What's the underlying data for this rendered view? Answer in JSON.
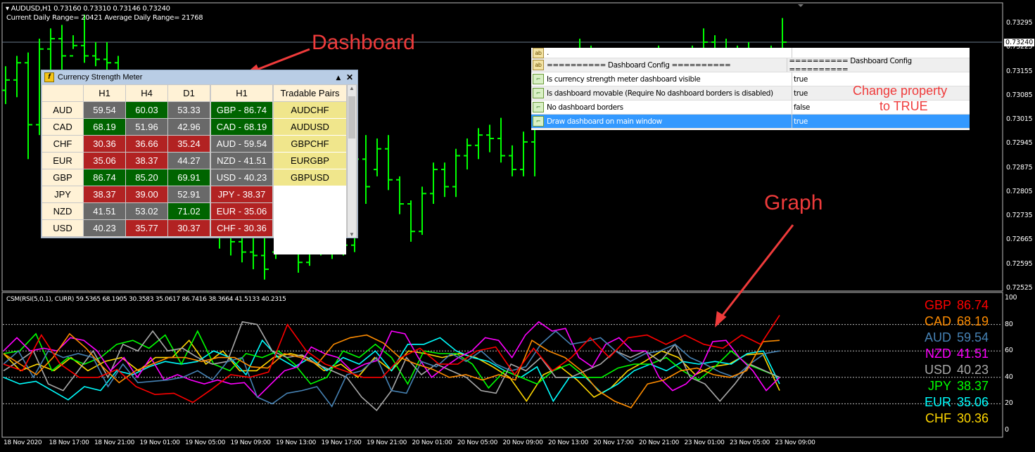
{
  "header": {
    "symbol_line": "AUDUSD,H1  0.73160 0.73310 0.73146 0.73240",
    "range_line": "Current Daily Range= 20421    Average Daily Range= 21768"
  },
  "price_axis": {
    "labels": [
      "0.73295",
      "0.73225",
      "0.73155",
      "0.73085",
      "0.73015",
      "0.72945",
      "0.72875",
      "0.72805",
      "0.72735",
      "0.72665",
      "0.72595",
      "0.72525"
    ],
    "current": "0.73240",
    "current_value": 0.7324
  },
  "price_bars_ohlc": [
    [
      0.731,
      0.7317,
      0.7306,
      0.7313
    ],
    [
      0.7313,
      0.732,
      0.7308,
      0.7318
    ],
    [
      0.7318,
      0.7321,
      0.729,
      0.73
    ],
    [
      0.73,
      0.7325,
      0.7297,
      0.7322
    ],
    [
      0.7322,
      0.7328,
      0.7316,
      0.7325
    ],
    [
      0.7325,
      0.7329,
      0.7315,
      0.732
    ],
    [
      0.732,
      0.7326,
      0.7322,
      0.7323
    ],
    [
      0.7323,
      0.7332,
      0.7318,
      0.732
    ],
    [
      0.732,
      0.7324,
      0.7317,
      0.7319
    ],
    [
      0.7319,
      0.7324,
      0.7316,
      0.7318
    ],
    [
      0.7318,
      0.732,
      0.7305,
      0.7308
    ],
    [
      0.7308,
      0.7312,
      0.73,
      0.7303
    ],
    [
      0.7303,
      0.7306,
      0.7294,
      0.7297
    ],
    [
      0.7297,
      0.7301,
      0.729,
      0.7292
    ],
    [
      0.7292,
      0.7296,
      0.7285,
      0.7288
    ],
    [
      0.7288,
      0.7292,
      0.728,
      0.7284
    ],
    [
      0.7284,
      0.7287,
      0.7276,
      0.7279
    ],
    [
      0.7279,
      0.7283,
      0.7272,
      0.7275
    ],
    [
      0.7275,
      0.7279,
      0.7268,
      0.7271
    ],
    [
      0.7271,
      0.7275,
      0.7264,
      0.7268
    ],
    [
      0.7268,
      0.7272,
      0.7262,
      0.7266
    ],
    [
      0.7266,
      0.727,
      0.726,
      0.7263
    ],
    [
      0.7263,
      0.7268,
      0.7258,
      0.7262
    ],
    [
      0.7262,
      0.7269,
      0.7255,
      0.7258
    ],
    [
      0.7263,
      0.7269,
      0.7261,
      0.7266
    ],
    [
      0.7266,
      0.7269,
      0.7264,
      0.7265
    ],
    [
      0.7265,
      0.7271,
      0.7257,
      0.726
    ],
    [
      0.726,
      0.7269,
      0.7259,
      0.7266
    ],
    [
      0.7266,
      0.7269,
      0.7262,
      0.7264
    ],
    [
      0.7264,
      0.7269,
      0.7261,
      0.7267
    ],
    [
      0.7267,
      0.7269,
      0.7262,
      0.7265
    ],
    [
      0.7265,
      0.7294,
      0.7263,
      0.729
    ],
    [
      0.729,
      0.7297,
      0.7277,
      0.7282
    ],
    [
      0.7287,
      0.7296,
      0.7285,
      0.7293
    ],
    [
      0.7293,
      0.7297,
      0.7281,
      0.7284
    ],
    [
      0.7284,
      0.7285,
      0.7274,
      0.7277
    ],
    [
      0.7277,
      0.7278,
      0.7266,
      0.7269
    ],
    [
      0.7269,
      0.7282,
      0.7268,
      0.728
    ],
    [
      0.728,
      0.7289,
      0.7277,
      0.7287
    ],
    [
      0.7287,
      0.7289,
      0.7279,
      0.7282
    ],
    [
      0.7282,
      0.7293,
      0.7279,
      0.7291
    ],
    [
      0.7291,
      0.7296,
      0.7287,
      0.7294
    ],
    [
      0.7294,
      0.7299,
      0.729,
      0.7297
    ],
    [
      0.7297,
      0.73,
      0.7292,
      0.7296
    ],
    [
      0.7296,
      0.7302,
      0.7289,
      0.7291
    ],
    [
      0.7291,
      0.7294,
      0.7285,
      0.7287
    ],
    [
      0.7287,
      0.7298,
      0.7285,
      0.7295
    ],
    [
      0.7295,
      0.7308,
      0.7285,
      0.7304
    ],
    [
      0.7304,
      0.7312,
      0.73,
      0.731
    ],
    [
      0.731,
      0.7318,
      0.7306,
      0.7315
    ],
    [
      0.7315,
      0.7322,
      0.7312,
      0.7319
    ],
    [
      0.7319,
      0.7325,
      0.7315,
      0.7322
    ],
    [
      0.7322,
      0.7323,
      0.7312,
      0.7314
    ],
    [
      0.7314,
      0.7319,
      0.7308,
      0.7317
    ],
    [
      0.7317,
      0.7321,
      0.731,
      0.7313
    ],
    [
      0.7313,
      0.7318,
      0.7306,
      0.7315
    ],
    [
      0.7315,
      0.732,
      0.7309,
      0.7318
    ],
    [
      0.7318,
      0.7322,
      0.7312,
      0.732
    ],
    [
      0.732,
      0.7323,
      0.7314,
      0.7316
    ],
    [
      0.7316,
      0.7321,
      0.731,
      0.7319
    ],
    [
      0.7319,
      0.7322,
      0.7313,
      0.7317
    ],
    [
      0.7317,
      0.7323,
      0.7314,
      0.7321
    ],
    [
      0.7321,
      0.7328,
      0.7318,
      0.7324
    ],
    [
      0.7324,
      0.7326,
      0.7318,
      0.7322
    ],
    [
      0.7322,
      0.7325,
      0.7316,
      0.7319
    ],
    [
      0.7319,
      0.7323,
      0.7314,
      0.7321
    ],
    [
      0.7321,
      0.7324,
      0.7316,
      0.7318
    ],
    [
      0.7318,
      0.7322,
      0.7313,
      0.732
    ],
    [
      0.732,
      0.7323,
      0.7315,
      0.7321
    ],
    [
      0.7321,
      0.7331,
      0.732,
      0.7324
    ]
  ],
  "bar_color": "#00ff00",
  "indicator": {
    "title": "CSM(RSI(5,0,1), CURR) 59.5365 68.1905 30.3583 35.0617 86.7416 38.3664 41.5133 40.2315",
    "y_labels": [
      "100",
      "80",
      "60",
      "40",
      "20",
      "0"
    ],
    "grid_levels": [
      80,
      60,
      40,
      20
    ],
    "series": [
      {
        "name": "GBP",
        "value": "86.74",
        "color": "#ff0000",
        "values": [
          50,
          45,
          72,
          50,
          40,
          40,
          46,
          33,
          27,
          28,
          21,
          31,
          42,
          40,
          44,
          80,
          60,
          50,
          45,
          40,
          40,
          55,
          62,
          50,
          50,
          60,
          63,
          42,
          62,
          45,
          55,
          70,
          55,
          70,
          72,
          65,
          72,
          65,
          62,
          72,
          65,
          87
        ]
      },
      {
        "name": "CAD",
        "value": "68.19",
        "color": "#ff8c00",
        "values": [
          58,
          50,
          42,
          55,
          73,
          62,
          48,
          36,
          45,
          50,
          55,
          55,
          52,
          55,
          55,
          48,
          47,
          58,
          55,
          50,
          65,
          70,
          72,
          66,
          55,
          50,
          46,
          40,
          42,
          38,
          42,
          38,
          68,
          60,
          55,
          45,
          30,
          22,
          17,
          35,
          38,
          45,
          47,
          42,
          40,
          45,
          67,
          68
        ]
      },
      {
        "name": "AUD",
        "value": "59.54",
        "color": "#4682b4",
        "values": [
          50,
          60,
          40,
          60,
          55,
          58,
          55,
          33,
          50,
          36,
          37,
          38,
          40,
          45,
          38,
          52,
          55,
          25,
          20,
          28,
          30,
          33,
          18,
          42,
          45,
          55,
          30,
          28,
          52,
          48,
          58,
          52,
          60,
          50,
          45,
          48,
          65,
          75,
          65,
          67,
          70,
          60,
          52,
          58,
          60,
          65,
          55,
          50,
          44,
          40,
          50,
          58,
          60
        ]
      },
      {
        "name": "NZD",
        "value": "41.51",
        "color": "#ff00ff",
        "values": [
          60,
          70,
          60,
          62,
          60,
          70,
          68,
          60,
          45,
          55,
          40,
          55,
          38,
          42,
          38,
          35,
          38,
          35,
          36,
          25,
          35,
          45,
          48,
          63,
          58,
          55,
          45,
          50,
          53,
          75,
          73,
          55,
          40,
          48,
          55,
          60,
          70,
          68,
          55,
          72,
          82,
          75,
          77,
          55,
          48,
          65,
          70,
          60,
          60,
          40,
          30,
          35,
          45,
          67,
          68,
          55,
          45,
          30,
          40
        ]
      },
      {
        "name": "USD",
        "value": "40.23",
        "color": "#a9a9a9",
        "values": [
          45,
          52,
          60,
          35,
          30,
          45,
          60,
          40,
          65,
          60,
          75,
          60,
          62,
          55,
          50,
          52,
          82,
          80,
          60,
          55,
          57,
          50,
          45,
          40,
          25,
          15,
          30,
          55,
          42,
          50,
          45,
          40,
          30,
          28,
          50,
          45,
          55,
          40,
          40,
          45,
          50,
          60,
          55,
          60,
          52,
          65,
          40,
          35,
          22,
          35,
          50,
          45,
          40
        ]
      },
      {
        "name": "JPY",
        "value": "38.37",
        "color": "#00ff00",
        "values": [
          58,
          60,
          73,
          45,
          55,
          50,
          55,
          65,
          68,
          62,
          72,
          50,
          75,
          50,
          45,
          58,
          55,
          60,
          50,
          35,
          40,
          60,
          55,
          65,
          55,
          35,
          60,
          58,
          58,
          50,
          32,
          45,
          40,
          35,
          45,
          50,
          40,
          40,
          47,
          50,
          50,
          55,
          45,
          38,
          48,
          60,
          50,
          45,
          40
        ]
      },
      {
        "name": "EUR",
        "value": "35.06",
        "color": "#00ffff",
        "values": [
          40,
          35,
          37,
          30,
          23,
          33,
          30,
          45,
          42,
          48,
          52,
          50,
          52,
          60,
          55,
          42,
          68,
          55,
          48,
          55,
          45,
          55,
          50,
          60,
          45,
          65,
          65,
          70,
          60,
          55,
          52,
          45,
          40,
          48,
          22,
          40,
          40,
          28,
          35,
          45,
          50,
          45,
          52,
          50,
          52,
          50,
          58,
          60,
          35
        ]
      },
      {
        "name": "CHF",
        "value": "30.36",
        "color": "#ffd700",
        "values": [
          58,
          45,
          50,
          45,
          55,
          45,
          52,
          55,
          45,
          55,
          55,
          68,
          50,
          60,
          45,
          45,
          55,
          58,
          55,
          45,
          50,
          40,
          55,
          45,
          60,
          58,
          55,
          58,
          55,
          48,
          40,
          22,
          42,
          48,
          38,
          25,
          32,
          45,
          52,
          60,
          55,
          42,
          48,
          50,
          57,
          58,
          30
        ]
      }
    ]
  },
  "time_axis": [
    "18 Nov 2020",
    "18 Nov 17:00",
    "18 Nov 21:00",
    "19 Nov 01:00",
    "19 Nov 05:00",
    "19 Nov 09:00",
    "19 Nov 13:00",
    "19 Nov 17:00",
    "19 Nov 21:00",
    "20 Nov 01:00",
    "20 Nov 05:00",
    "20 Nov 09:00",
    "20 Nov 13:00",
    "20 Nov 17:00",
    "20 Nov 21:00",
    "23 Nov 01:00",
    "23 Nov 05:00",
    "23 Nov 09:00"
  ],
  "dashboard": {
    "title": "Currency Strength Meter",
    "headers": [
      "",
      "H1",
      "H4",
      "D1"
    ],
    "sorted_header": "H1",
    "pairs_header": "Tradable Pairs",
    "rows": [
      {
        "cur": "AUD",
        "vals": [
          [
            "59.54",
            "gr"
          ],
          [
            "60.03",
            "g"
          ],
          [
            "53.33",
            "gr"
          ]
        ]
      },
      {
        "cur": "CAD",
        "vals": [
          [
            "68.19",
            "g"
          ],
          [
            "51.96",
            "gr"
          ],
          [
            "42.96",
            "gr"
          ]
        ]
      },
      {
        "cur": "CHF",
        "vals": [
          [
            "30.36",
            "r"
          ],
          [
            "36.66",
            "r"
          ],
          [
            "35.24",
            "r"
          ]
        ]
      },
      {
        "cur": "EUR",
        "vals": [
          [
            "35.06",
            "r"
          ],
          [
            "38.37",
            "r"
          ],
          [
            "44.27",
            "gr"
          ]
        ]
      },
      {
        "cur": "GBP",
        "vals": [
          [
            "86.74",
            "g"
          ],
          [
            "85.20",
            "g"
          ],
          [
            "69.91",
            "g"
          ]
        ]
      },
      {
        "cur": "JPY",
        "vals": [
          [
            "38.37",
            "r"
          ],
          [
            "39.00",
            "r"
          ],
          [
            "52.91",
            "gr"
          ]
        ]
      },
      {
        "cur": "NZD",
        "vals": [
          [
            "41.51",
            "gr"
          ],
          [
            "53.02",
            "gr"
          ],
          [
            "71.02",
            "g"
          ]
        ]
      },
      {
        "cur": "USD",
        "vals": [
          [
            "40.23",
            "gr"
          ],
          [
            "35.77",
            "r"
          ],
          [
            "30.37",
            "r"
          ]
        ]
      }
    ],
    "sorted": [
      [
        "GBP - 86.74",
        "g"
      ],
      [
        "CAD - 68.19",
        "g"
      ],
      [
        "AUD - 59.54",
        "gr"
      ],
      [
        "NZD - 41.51",
        "gr"
      ],
      [
        "USD - 40.23",
        "gr"
      ],
      [
        "JPY - 38.37",
        "r"
      ],
      [
        "EUR - 35.06",
        "r"
      ],
      [
        "CHF - 30.36",
        "r"
      ]
    ],
    "pairs": [
      "AUDCHF",
      "AUDUSD",
      "GBPCHF",
      "EURGBP",
      "GBPUSD"
    ],
    "colors": {
      "green": "#006400",
      "gray": "#696969",
      "red": "#b22222"
    }
  },
  "properties": [
    {
      "icon": "ab",
      "key": ".",
      "value": ""
    },
    {
      "icon": "ab",
      "key": "========== Dashboard Config ==========",
      "value": "========== Dashboard Config =========="
    },
    {
      "icon": "bool",
      "key": "Is currency strength meter dashboard visible",
      "value": "true"
    },
    {
      "icon": "bool",
      "key": "Is dashboard movable (Require No dashboard borders is disabled)",
      "value": "true"
    },
    {
      "icon": "bool",
      "key": "No dashboard borders",
      "value": "false"
    },
    {
      "icon": "bool",
      "key": "Draw dashboard on main window",
      "value": "true",
      "selected": true
    }
  ],
  "annotations": {
    "dashboard": "Dashboard",
    "graph": "Graph",
    "change": "Change property",
    "change2": "to TRUE",
    "color": "#ef3b3b"
  }
}
